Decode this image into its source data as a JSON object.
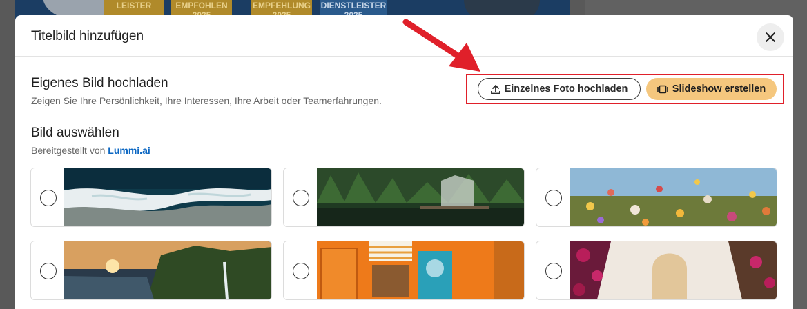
{
  "background": {
    "badges": [
      "LEISTER",
      "EMPFOHLEN\n2025",
      "EMPFEHLUNG\n2025",
      "DIENSTLEISTER\n2025"
    ]
  },
  "dialog": {
    "title": "Titelbild hinzufügen",
    "close_icon": "close-icon"
  },
  "upload_section": {
    "title": "Eigenes Bild hochladen",
    "subtitle": "Zeigen Sie Ihre Persönlichkeit, Ihre Interessen, Ihre Arbeit oder Teamerfahrungen.",
    "single_photo_label": "Einzelnes Foto hochladen",
    "slideshow_label": "Slideshow erstellen",
    "upload_icon": "upload-icon",
    "slideshow_icon": "slideshow-icon"
  },
  "select_section": {
    "title": "Bild auswählen",
    "provided_by": "Bereitgestellt von ",
    "provider": "Lummi.ai"
  },
  "images": [
    {
      "name": "aerial-ocean-waves",
      "selected": false
    },
    {
      "name": "forest-lake-greenhouse",
      "selected": false
    },
    {
      "name": "wildflower-meadow",
      "selected": false
    },
    {
      "name": "coastal-cliffs-sunset",
      "selected": false
    },
    {
      "name": "orange-storefront-bakery",
      "selected": false
    },
    {
      "name": "white-arch-bougainvillea",
      "selected": false
    }
  ],
  "colors": {
    "accent_button": "#f5c77e",
    "link": "#0a66c2",
    "annotation": "#e0202a"
  }
}
